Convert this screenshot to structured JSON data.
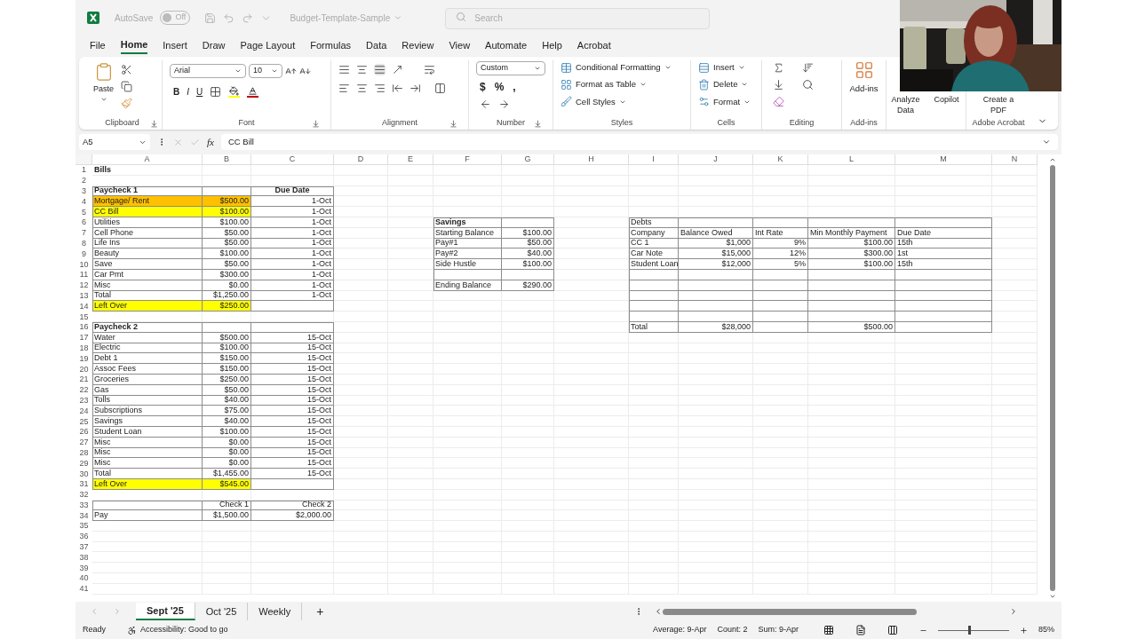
{
  "title_bar": {
    "autosave_label": "AutoSave",
    "autosave": {
      "on": false,
      "label": "Off"
    },
    "file_name": "Budget-Template-Sample",
    "search_placeholder": "Search"
  },
  "menu_tabs": [
    {
      "label": "File",
      "selected": false
    },
    {
      "label": "Home",
      "selected": true
    },
    {
      "label": "Insert",
      "selected": false
    },
    {
      "label": "Draw",
      "selected": false
    },
    {
      "label": "Page Layout",
      "selected": false
    },
    {
      "label": "Formulas",
      "selected": false
    },
    {
      "label": "Data",
      "selected": false
    },
    {
      "label": "Review",
      "selected": false
    },
    {
      "label": "View",
      "selected": false
    },
    {
      "label": "Automate",
      "selected": false
    },
    {
      "label": "Help",
      "selected": false
    },
    {
      "label": "Acrobat",
      "selected": false
    }
  ],
  "ribbon": {
    "clipboard": {
      "label": "Clipboard",
      "paste": "Paste"
    },
    "font": {
      "label": "Font",
      "family": "Arial",
      "size": "10",
      "styles": [
        "B",
        "I",
        "U"
      ]
    },
    "alignment": {
      "label": "Alignment"
    },
    "number": {
      "label": "Number",
      "format": "Custom",
      "symbols": [
        "$",
        "%",
        ","
      ]
    },
    "styles": {
      "label": "Styles",
      "buttons": [
        "Conditional Formatting",
        "Format as Table",
        "Cell Styles"
      ]
    },
    "cells": {
      "label": "Cells",
      "buttons": [
        "Insert",
        "Delete",
        "Format"
      ]
    },
    "editing": {
      "label": "Editing"
    },
    "addins": {
      "label": "Add-ins",
      "button": "Add-ins"
    },
    "analyze": {
      "buttons": [
        "Analyze Data",
        "Copilot"
      ]
    },
    "acrobat": {
      "label": "Adobe Acrobat",
      "button": "Create a PDF"
    }
  },
  "formula_bar": {
    "name_box": "A5",
    "fx": "fx",
    "content": "CC Bill"
  },
  "sheet": {
    "columns": [
      "A",
      "B",
      "C",
      "D",
      "E",
      "F",
      "G",
      "H",
      "I",
      "J",
      "K",
      "L",
      "M",
      "N"
    ],
    "rows": [
      {
        "number": "1",
        "cells": {
          "A": {
            "text": "Bills",
            "bold": true
          }
        }
      },
      {
        "number": "2"
      },
      {
        "number": "3",
        "cells": {
          "A": {
            "text": "Paycheck 1",
            "bold": true,
            "boxed": true
          },
          "B": {
            "boxed": true
          },
          "C": {
            "text": "Due Date",
            "bold": true,
            "center": true,
            "boxed": true
          }
        }
      },
      {
        "number": "4",
        "cells": {
          "A": {
            "text": "Mortgage/ Rent",
            "color": "#ffc000",
            "boxed": true
          },
          "B": {
            "text": "$500.00",
            "right": true,
            "color": "#ffc000",
            "boxed": true
          },
          "C": {
            "text": "1-Oct",
            "right": true,
            "boxed": true
          }
        }
      },
      {
        "number": "5",
        "cells": {
          "A": {
            "text": "CC Bill",
            "color": "#ffff00",
            "boxed": true
          },
          "B": {
            "text": "$100.00",
            "right": true,
            "color": "#ffff00",
            "boxed": true
          },
          "C": {
            "text": "1-Oct",
            "right": true,
            "boxed": true
          }
        }
      },
      {
        "number": "6",
        "cells": {
          "A": {
            "text": "Utilities",
            "boxed": true
          },
          "B": {
            "text": "$100.00",
            "right": true,
            "boxed": true
          },
          "C": {
            "text": "1-Oct",
            "right": true,
            "boxed": true
          },
          "F": {
            "text": "Savings",
            "bold": true,
            "boxed": true
          },
          "G": {
            "boxed": true
          },
          "I": {
            "text": "Debts",
            "boxed": true
          },
          "J": {
            "boxed": true
          },
          "K": {
            "boxed": true
          },
          "L": {
            "boxed": true
          },
          "M": {
            "boxed": true
          }
        }
      },
      {
        "number": "7",
        "cells": {
          "A": {
            "text": "Cell Phone",
            "boxed": true
          },
          "B": {
            "text": "$50.00",
            "right": true,
            "boxed": true
          },
          "C": {
            "text": "1-Oct",
            "right": true,
            "boxed": true
          },
          "F": {
            "text": "Starting Balance",
            "boxed": true
          },
          "G": {
            "text": "$100.00",
            "right": true,
            "boxed": true
          },
          "I": {
            "text": "Company",
            "boxed": true
          },
          "J": {
            "text": "Balance Owed",
            "boxed": true
          },
          "K": {
            "text": "Int Rate",
            "boxed": true
          },
          "L": {
            "text": "Min Monthly Payment",
            "boxed": true
          },
          "M": {
            "text": "Due Date",
            "boxed": true
          }
        }
      },
      {
        "number": "8",
        "cells": {
          "A": {
            "text": "Life Ins",
            "boxed": true
          },
          "B": {
            "text": "$50.00",
            "right": true,
            "boxed": true
          },
          "C": {
            "text": "1-Oct",
            "right": true,
            "boxed": true
          },
          "F": {
            "text": "Pay#1",
            "boxed": true
          },
          "G": {
            "text": "$50.00",
            "right": true,
            "boxed": true
          },
          "I": {
            "text": "CC 1",
            "boxed": true
          },
          "J": {
            "text": "$1,000",
            "right": true,
            "boxed": true
          },
          "K": {
            "text": "9%",
            "right": true,
            "boxed": true
          },
          "L": {
            "text": "$100.00",
            "right": true,
            "boxed": true
          },
          "M": {
            "text": "15th",
            "boxed": true
          }
        }
      },
      {
        "number": "9",
        "cells": {
          "A": {
            "text": "Beauty",
            "boxed": true
          },
          "B": {
            "text": "$100.00",
            "right": true,
            "boxed": true
          },
          "C": {
            "text": "1-Oct",
            "right": true,
            "boxed": true
          },
          "F": {
            "text": "Pay#2",
            "boxed": true
          },
          "G": {
            "text": "$40.00",
            "right": true,
            "boxed": true
          },
          "I": {
            "text": "Car Note",
            "boxed": true
          },
          "J": {
            "text": "$15,000",
            "right": true,
            "boxed": true
          },
          "K": {
            "text": "12%",
            "right": true,
            "boxed": true
          },
          "L": {
            "text": "$300.00",
            "right": true,
            "boxed": true
          },
          "M": {
            "text": "1st",
            "boxed": true
          }
        }
      },
      {
        "number": "10",
        "cells": {
          "A": {
            "text": "Save",
            "boxed": true
          },
          "B": {
            "text": "$50.00",
            "right": true,
            "boxed": true
          },
          "C": {
            "text": "1-Oct",
            "right": true,
            "boxed": true
          },
          "F": {
            "text": "Side Hustle",
            "boxed": true
          },
          "G": {
            "text": "$100.00",
            "right": true,
            "boxed": true
          },
          "I": {
            "text": "Student Loan",
            "boxed": true
          },
          "J": {
            "text": "$12,000",
            "right": true,
            "boxed": true
          },
          "K": {
            "text": "5%",
            "right": true,
            "boxed": true
          },
          "L": {
            "text": "$100.00",
            "right": true,
            "boxed": true
          },
          "M": {
            "text": "15th",
            "boxed": true
          }
        }
      },
      {
        "number": "11",
        "cells": {
          "A": {
            "text": "Car Pmt",
            "boxed": true
          },
          "B": {
            "text": "$300.00",
            "right": true,
            "boxed": true
          },
          "C": {
            "text": "1-Oct",
            "right": true,
            "boxed": true
          },
          "F": {
            "boxed": true
          },
          "G": {
            "boxed": true
          },
          "I": {
            "boxed": true
          },
          "J": {
            "boxed": true
          },
          "K": {
            "boxed": true
          },
          "L": {
            "boxed": true
          },
          "M": {
            "boxed": true
          }
        }
      },
      {
        "number": "12",
        "cells": {
          "A": {
            "text": "Misc",
            "boxed": true
          },
          "B": {
            "text": "$0.00",
            "right": true,
            "boxed": true
          },
          "C": {
            "text": "1-Oct",
            "right": true,
            "boxed": true
          },
          "F": {
            "text": "Ending Balance",
            "boxed": true
          },
          "G": {
            "text": "$290.00",
            "right": true,
            "boxed": true
          },
          "I": {
            "boxed": true
          },
          "J": {
            "boxed": true
          },
          "K": {
            "boxed": true
          },
          "L": {
            "boxed": true
          },
          "M": {
            "boxed": true
          }
        }
      },
      {
        "number": "13",
        "cells": {
          "A": {
            "text": "Total",
            "boxed": true
          },
          "B": {
            "text": "$1,250.00",
            "right": true,
            "boxed": true
          },
          "C": {
            "text": "1-Oct",
            "right": true,
            "boxed": true
          },
          "I": {
            "boxed": true
          },
          "J": {
            "boxed": true
          },
          "K": {
            "boxed": true
          },
          "L": {
            "boxed": true
          },
          "M": {
            "boxed": true
          }
        }
      },
      {
        "number": "14",
        "cells": {
          "A": {
            "text": "Left Over",
            "color": "#ffff00",
            "boxed": true
          },
          "B": {
            "text": "$250.00",
            "right": true,
            "color": "#ffff00",
            "boxed": true
          },
          "C": {
            "boxed": true
          },
          "I": {
            "boxed": true
          },
          "J": {
            "boxed": true
          },
          "K": {
            "boxed": true
          },
          "L": {
            "boxed": true
          },
          "M": {
            "boxed": true
          }
        }
      },
      {
        "number": "15",
        "cells": {
          "I": {
            "boxed": true
          },
          "J": {
            "boxed": true
          },
          "K": {
            "boxed": true
          },
          "L": {
            "boxed": true
          },
          "M": {
            "boxed": true
          }
        }
      },
      {
        "number": "16",
        "cells": {
          "A": {
            "text": "Paycheck 2",
            "bold": true,
            "boxed": true
          },
          "B": {
            "boxed": true
          },
          "C": {
            "boxed": true
          },
          "I": {
            "text": "Total",
            "boxed": true
          },
          "J": {
            "text": "$28,000",
            "right": true,
            "boxed": true
          },
          "K": {
            "boxed": true
          },
          "L": {
            "text": "$500.00",
            "right": true,
            "boxed": true
          },
          "M": {
            "boxed": true
          }
        }
      },
      {
        "number": "17",
        "cells": {
          "A": {
            "text": "Water",
            "boxed": true
          },
          "B": {
            "text": "$500.00",
            "right": true,
            "boxed": true
          },
          "C": {
            "text": "15-Oct",
            "right": true,
            "boxed": true
          }
        }
      },
      {
        "number": "18",
        "cells": {
          "A": {
            "text": "Electric",
            "boxed": true
          },
          "B": {
            "text": "$100.00",
            "right": true,
            "boxed": true
          },
          "C": {
            "text": "15-Oct",
            "right": true,
            "boxed": true
          }
        }
      },
      {
        "number": "19",
        "cells": {
          "A": {
            "text": "Debt 1",
            "boxed": true
          },
          "B": {
            "text": "$150.00",
            "right": true,
            "boxed": true
          },
          "C": {
            "text": "15-Oct",
            "right": true,
            "boxed": true
          }
        }
      },
      {
        "number": "20",
        "cells": {
          "A": {
            "text": "Assoc Fees",
            "boxed": true
          },
          "B": {
            "text": "$150.00",
            "right": true,
            "boxed": true
          },
          "C": {
            "text": "15-Oct",
            "right": true,
            "boxed": true
          }
        }
      },
      {
        "number": "21",
        "cells": {
          "A": {
            "text": "Groceries",
            "boxed": true
          },
          "B": {
            "text": "$250.00",
            "right": true,
            "boxed": true
          },
          "C": {
            "text": "15-Oct",
            "right": true,
            "boxed": true
          }
        }
      },
      {
        "number": "22",
        "cells": {
          "A": {
            "text": "Gas",
            "boxed": true
          },
          "B": {
            "text": "$50.00",
            "right": true,
            "boxed": true
          },
          "C": {
            "text": "15-Oct",
            "right": true,
            "boxed": true
          }
        }
      },
      {
        "number": "23",
        "cells": {
          "A": {
            "text": "Tolls",
            "boxed": true
          },
          "B": {
            "text": "$40.00",
            "right": true,
            "boxed": true
          },
          "C": {
            "text": "15-Oct",
            "right": true,
            "boxed": true
          }
        }
      },
      {
        "number": "24",
        "cells": {
          "A": {
            "text": "Subscriptions",
            "boxed": true
          },
          "B": {
            "text": "$75.00",
            "right": true,
            "boxed": true
          },
          "C": {
            "text": "15-Oct",
            "right": true,
            "boxed": true
          }
        }
      },
      {
        "number": "25",
        "cells": {
          "A": {
            "text": "Savings",
            "boxed": true
          },
          "B": {
            "text": "$40.00",
            "right": true,
            "boxed": true
          },
          "C": {
            "text": "15-Oct",
            "right": true,
            "boxed": true
          }
        }
      },
      {
        "number": "26",
        "cells": {
          "A": {
            "text": "Student Loan",
            "boxed": true
          },
          "B": {
            "text": "$100.00",
            "right": true,
            "boxed": true
          },
          "C": {
            "text": "15-Oct",
            "right": true,
            "boxed": true
          }
        }
      },
      {
        "number": "27",
        "cells": {
          "A": {
            "text": "Misc",
            "boxed": true
          },
          "B": {
            "text": "$0.00",
            "right": true,
            "boxed": true
          },
          "C": {
            "text": "15-Oct",
            "right": true,
            "boxed": true
          }
        }
      },
      {
        "number": "28",
        "cells": {
          "A": {
            "text": "Misc",
            "boxed": true
          },
          "B": {
            "text": "$0.00",
            "right": true,
            "boxed": true
          },
          "C": {
            "text": "15-Oct",
            "right": true,
            "boxed": true
          }
        }
      },
      {
        "number": "29",
        "cells": {
          "A": {
            "text": "Misc",
            "boxed": true
          },
          "B": {
            "text": "$0.00",
            "right": true,
            "boxed": true
          },
          "C": {
            "text": "15-Oct",
            "right": true,
            "boxed": true
          }
        }
      },
      {
        "number": "30",
        "cells": {
          "A": {
            "text": "Total",
            "boxed": true
          },
          "B": {
            "text": "$1,455.00",
            "right": true,
            "boxed": true
          },
          "C": {
            "text": "15-Oct",
            "right": true,
            "boxed": true
          }
        }
      },
      {
        "number": "31",
        "cells": {
          "A": {
            "text": "Left Over",
            "color": "#ffff00",
            "boxed": true
          },
          "B": {
            "text": "$545.00",
            "right": true,
            "color": "#ffff00",
            "boxed": true
          },
          "C": {
            "boxed": true
          }
        }
      },
      {
        "number": "32"
      },
      {
        "number": "33",
        "cells": {
          "A": {
            "boxed": true
          },
          "B": {
            "text": "Check 1",
            "right": true,
            "boxed": true
          },
          "C": {
            "text": "Check 2",
            "right": true,
            "boxed": true
          }
        }
      },
      {
        "number": "34",
        "cells": {
          "A": {
            "text": "Pay",
            "boxed": true
          },
          "B": {
            "text": "$1,500.00",
            "right": true,
            "boxed": true
          },
          "C": {
            "text": "$2,000.00",
            "right": true,
            "boxed": true
          }
        }
      },
      {
        "number": "35"
      },
      {
        "number": "36"
      },
      {
        "number": "37"
      },
      {
        "number": "38"
      },
      {
        "number": "39"
      },
      {
        "number": "40"
      },
      {
        "number": "41"
      }
    ]
  },
  "sheet_tabs": [
    {
      "label": "Sept '25",
      "selected": true
    },
    {
      "label": "Oct '25",
      "selected": false
    },
    {
      "label": "Weekly",
      "selected": false
    }
  ],
  "add_sheet": "+",
  "status_bar": {
    "mode": "Ready",
    "accessibility": "Accessibility: Good to go",
    "average": "Average: 9-Apr",
    "count": "Count: 2",
    "sum": "Sum: 9-Apr",
    "zoom": {
      "level": 0.45,
      "label": "85%"
    }
  }
}
